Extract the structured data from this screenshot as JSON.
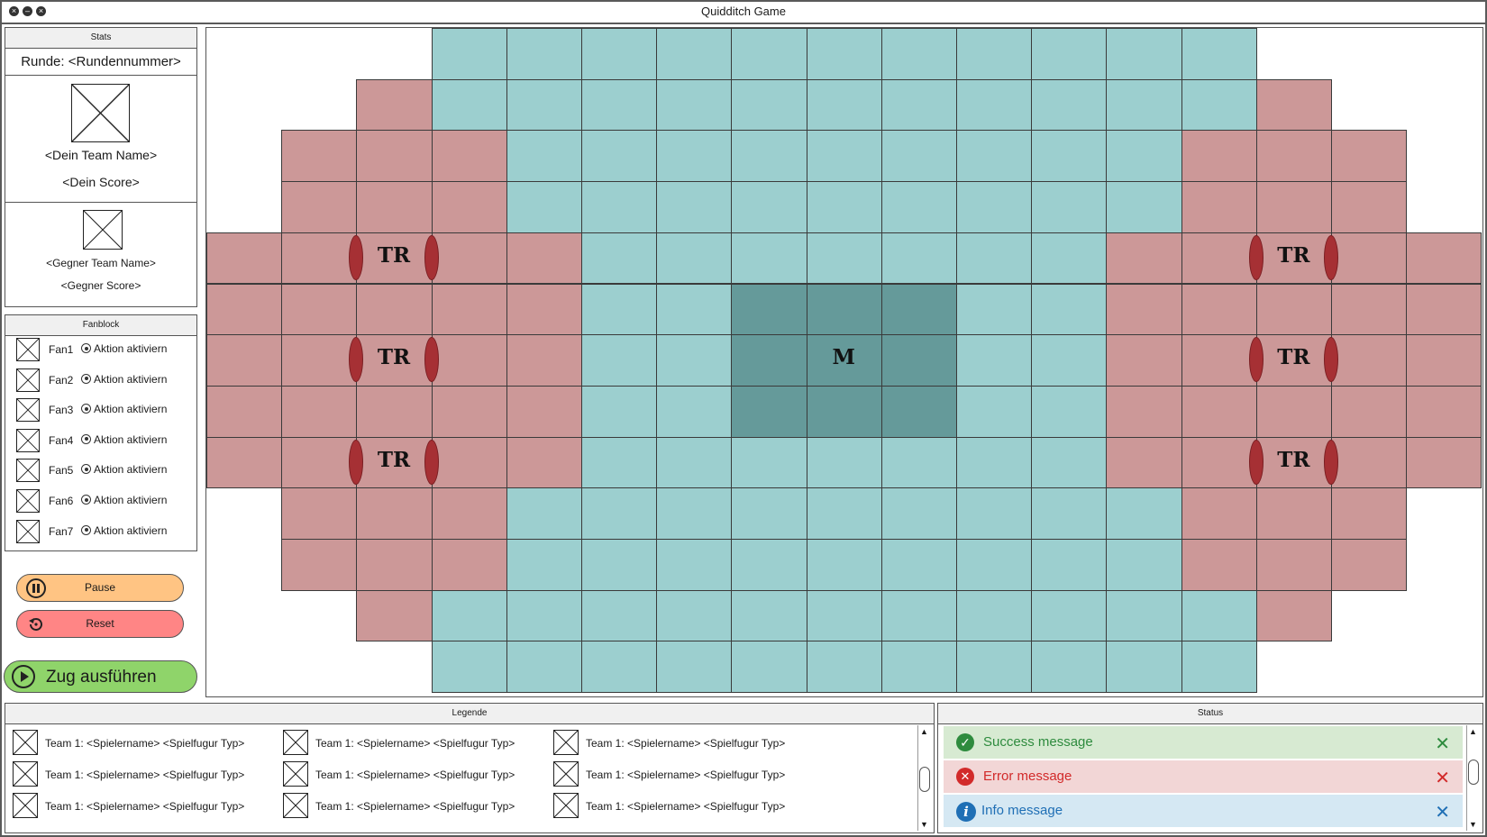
{
  "window": {
    "title": "Quidditch Game"
  },
  "stats": {
    "header": "Stats",
    "round": "Runde: <Rundennummer>",
    "my_team_name": "<Dein Team Name>",
    "my_score": "<Dein Score>",
    "opp_team_name": "<Gegner Team Name>",
    "opp_score": "<Gegner Score>"
  },
  "fanblock": {
    "header": "Fanblock",
    "fans": [
      {
        "name": "Fan1",
        "action": "Aktion aktiviern"
      },
      {
        "name": "Fan2",
        "action": "Aktion aktiviern"
      },
      {
        "name": "Fan3",
        "action": "Aktion aktiviern"
      },
      {
        "name": "Fan4",
        "action": "Aktion aktiviern"
      },
      {
        "name": "Fan5",
        "action": "Aktion aktiviern"
      },
      {
        "name": "Fan6",
        "action": "Aktion aktiviern"
      },
      {
        "name": "Fan7",
        "action": "Aktion aktiviern"
      }
    ]
  },
  "controls": {
    "pause_label": "Pause",
    "reset_label": "Reset",
    "execute_label": "Zug ausführen"
  },
  "board": {
    "goal_label": "TR",
    "center_label": "M",
    "colors": {
      "field": "#9ccfcf",
      "center": "#659a9a",
      "half": "#cc9898",
      "goal_ring": "#a63034",
      "grid": "#3a3a3a"
    }
  },
  "legend": {
    "header": "Legende",
    "entries": [
      "Team 1: <Spielername> <Spielfugur Typ>",
      "Team 1: <Spielername> <Spielfugur Typ>",
      "Team 1: <Spielername> <Spielfugur Typ>",
      "Team 1: <Spielername> <Spielfugur Typ>",
      "Team 1: <Spielername> <Spielfugur Typ>",
      "Team 1: <Spielername> <Spielfugur Typ>",
      "Team 1: <Spielername> <Spielfugur Typ>",
      "Team 1: <Spielername> <Spielfugur Typ>",
      "Team 1: <Spielername> <Spielfugur Typ>"
    ]
  },
  "status": {
    "header": "Status",
    "success": "Success message",
    "error": "Error message",
    "info": "Info message",
    "colors": {
      "success_bg": "#d7ead2",
      "error_bg": "#f2d6d6",
      "info_bg": "#d5e8f3",
      "success": "#2e8b3e",
      "error": "#d22a2a",
      "info": "#1f6fb5"
    }
  }
}
